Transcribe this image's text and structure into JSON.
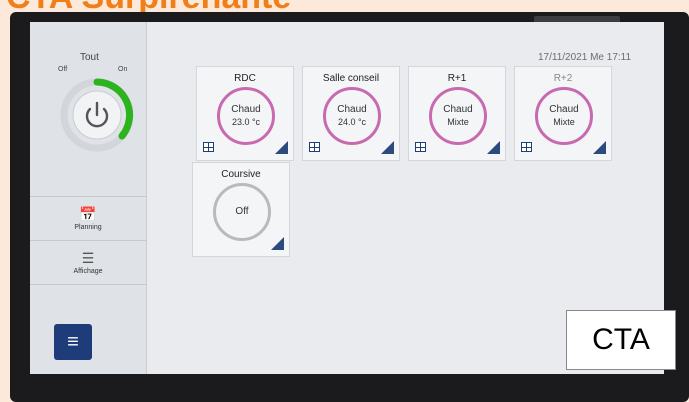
{
  "banner": {
    "text": "CTA Surpirenante"
  },
  "sidebar": {
    "power": {
      "title": "Tout",
      "off_label": "Off",
      "on_label": "On"
    },
    "buttons": [
      {
        "label": "Planning",
        "icon": "calendar-icon"
      },
      {
        "label": "Affichage",
        "icon": "list-icon"
      }
    ],
    "menu_icon": "hamburger-icon"
  },
  "header": {
    "datetime": "17/11/2021 Me 17:11"
  },
  "zones": [
    {
      "name": "RDC",
      "mode": "Chaud",
      "value": "23.0 °c",
      "state": "on"
    },
    {
      "name": "Salle conseil",
      "mode": "Chaud",
      "value": "24.0 °c",
      "state": "on"
    },
    {
      "name": "R+1",
      "mode": "Chaud",
      "value": "Mixte",
      "state": "on"
    },
    {
      "name": "R+2",
      "mode": "Chaud",
      "value": "Mixte",
      "state": "on"
    },
    {
      "name": "Coursive",
      "mode": "Off",
      "value": "",
      "state": "off"
    }
  ],
  "overlay": {
    "label": "CTA"
  },
  "colors": {
    "accent": "#2db31e",
    "ring_active": "#c86ab0",
    "menu": "#1f3c7a",
    "banner": "#f07f1a"
  }
}
